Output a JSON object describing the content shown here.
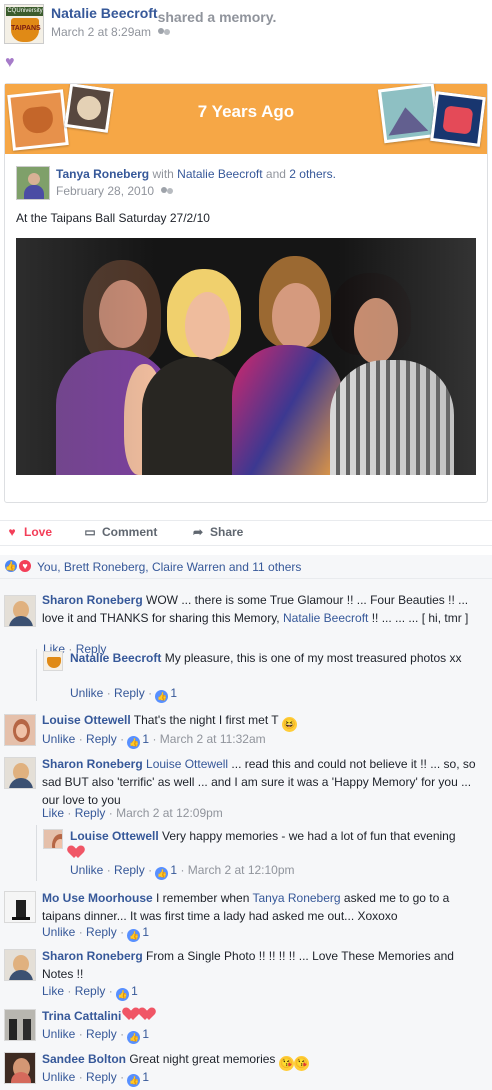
{
  "post": {
    "author": "Natalie Beecroft",
    "action": "shared a memory.",
    "date": "March 2 at 8:29am",
    "audience_icon": "friends-icon",
    "reaction_emoji": "purple-heart-icon",
    "avatar_logo_top": "CQUniversity",
    "avatar_logo_text": "TAIPANS"
  },
  "memory": {
    "banner_title": "7 Years Ago",
    "author": "Tanya Roneberg",
    "with": "with",
    "tagged_person": "Natalie Beecroft",
    "and": "and",
    "others": "2 others.",
    "date": "February 28, 2010",
    "caption": "At the Taipans Ball Saturday 27/2/10",
    "photo_alt": "Four women smiling at a ball"
  },
  "actions": {
    "love": "Love",
    "comment": "Comment",
    "share": "Share"
  },
  "reactions": {
    "summary": "You, Brett Roneberg, Claire Warren and 11 others"
  },
  "comments": [
    {
      "author": "Sharon Roneberg",
      "text_before": " WOW ... there is some True Glamour !! ... Four Beauties !! ... love it and THANKS for sharing this Memory, ",
      "mention": "Natalie Beecroft",
      "text_after": " !! ... ... ... [ hi, tmr ]",
      "links": [
        "Like",
        "Reply"
      ]
    },
    {
      "author": "Natalie Beecroft",
      "text": " My pleasure, this is one of my most treasured photos xx",
      "links": [
        "Unlike",
        "Reply"
      ],
      "likes": "1"
    },
    {
      "author": "Louise Ottewell",
      "text": " That's the night I first met T",
      "emoji": "grinning-squinting-face",
      "links": [
        "Unlike",
        "Reply"
      ],
      "likes": "1",
      "time": "March 2 at 11:32am"
    },
    {
      "author": "Sharon Roneberg",
      "mention": "Louise Ottewell",
      "text": " ... read this and could not believe it !! ... so, so sad BUT also 'terrific' as well ... and I am sure it was a 'Happy Memory' for you ... our love to you",
      "links": [
        "Like",
        "Reply"
      ],
      "time": "March 2 at 12:09pm"
    },
    {
      "author": "Louise Ottewell",
      "text": " Very happy memories - we had a lot of fun that evening",
      "emoji": "heart",
      "links": [
        "Unlike",
        "Reply"
      ],
      "likes": "1",
      "time": "March 2 at 12:10pm"
    },
    {
      "author": "Mo Use Moorhouse",
      "text_before": " I remember when ",
      "mention": "Tanya Roneberg",
      "text_after": " asked me to go to a taipans dinner... It was first time a lady had asked me out... Xoxoxo",
      "links": [
        "Unlike",
        "Reply"
      ],
      "likes": "1"
    },
    {
      "author": "Sharon Roneberg",
      "text": " From a Single Photo !! !! !! !! ... Love These Memories and Notes !!",
      "links": [
        "Like",
        "Reply"
      ],
      "likes": "1"
    },
    {
      "author": "Trina Cattalini",
      "emoji": "hearts",
      "links": [
        "Unlike",
        "Reply"
      ],
      "likes": "1"
    },
    {
      "author": "Sandee Bolton",
      "text": " Great night great memories",
      "emoji": "kissing-faces",
      "links": [
        "Unlike",
        "Reply"
      ],
      "likes": "1"
    }
  ],
  "symbols": {
    "separator": "·",
    "like_glyph": "👍",
    "heart_glyph": "♥",
    "comment_glyph": "▭",
    "share_glyph": "➦",
    "grin_glyph": "😆",
    "kiss_glyph": "😘"
  }
}
